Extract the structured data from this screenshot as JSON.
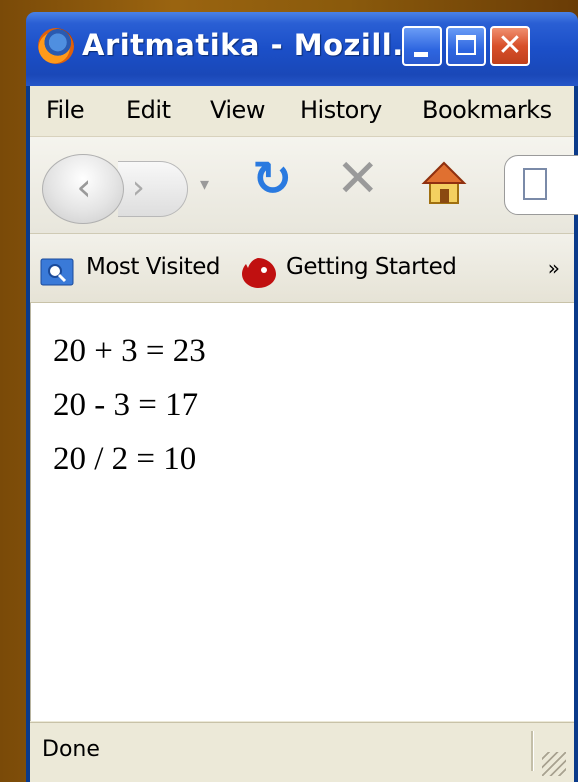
{
  "window": {
    "title": "Aritmatika - Mozill..."
  },
  "menu": {
    "items": [
      "File",
      "Edit",
      "View",
      "History",
      "Bookmarks"
    ]
  },
  "nav": {
    "back_icon": "chevron-left-icon",
    "forward_icon": "chevron-right-icon",
    "reload_icon": "reload-icon",
    "stop_icon": "stop-icon",
    "home_icon": "home-icon"
  },
  "bookmarks": {
    "items": [
      "Most Visited",
      "Getting Started"
    ],
    "overflow": "»"
  },
  "content": {
    "lines": [
      "20 + 3 = 23",
      "20 - 3 = 17",
      "20 / 2 = 10"
    ]
  },
  "status": {
    "text": "Done"
  },
  "colors": {
    "titlebar": "#1b4fc8",
    "close_button": "#d8502a",
    "reload": "#2a7ae0"
  }
}
